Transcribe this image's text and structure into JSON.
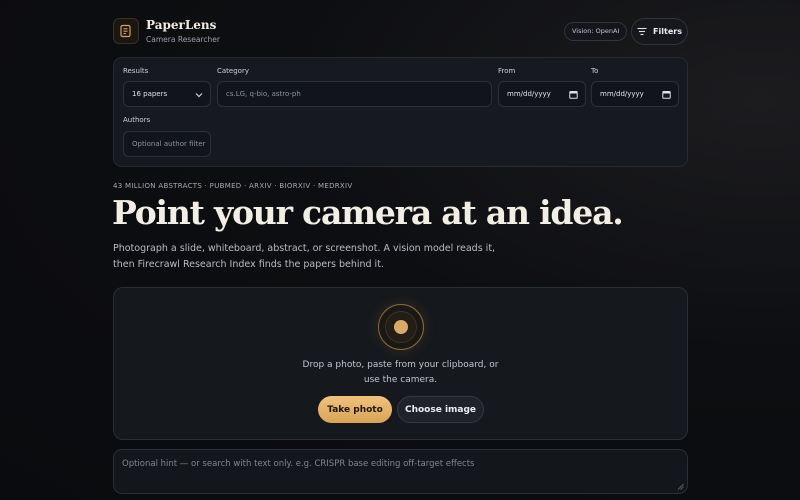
{
  "app": {
    "name": "PaperLens",
    "subtitle": "Camera Researcher",
    "logo_icon": "document-icon"
  },
  "header": {
    "vision_badge": "Vision: OpenAI",
    "filters_label": "Filters",
    "filters_icon": "filter-lines-icon"
  },
  "filters": {
    "results_label": "Results",
    "results_value": "16 papers",
    "category_label": "Category",
    "category_placeholder": "cs.LG, q-bio, astro-ph",
    "from_label": "From",
    "from_placeholder": "mm/dd/yyyy",
    "to_label": "To",
    "to_placeholder": "mm/dd/yyyy",
    "authors_label": "Authors",
    "authors_placeholder": "Optional author filter"
  },
  "hero": {
    "sources": "43 MILLION ABSTRACTS · PUBMED · ARXIV · BIORXIV · MEDRXIV",
    "title": "Point your camera at an idea.",
    "description_line1": "Photograph a slide, whiteboard, abstract, or screenshot. A vision model reads it,",
    "description_line2": "then Firecrawl Research Index finds the papers behind it."
  },
  "dropzone": {
    "text_line1": "Drop a photo, paste from your clipboard, or",
    "text_line2": "use the camera.",
    "take_photo": "Take photo",
    "choose_image": "Choose image"
  },
  "hint": {
    "placeholder": "Optional hint — or search with text only. e.g. CRISPR base editing off-target effects"
  },
  "colors": {
    "accent": "#d9a457",
    "background": "#0d0e11",
    "panel": "#161a20"
  }
}
